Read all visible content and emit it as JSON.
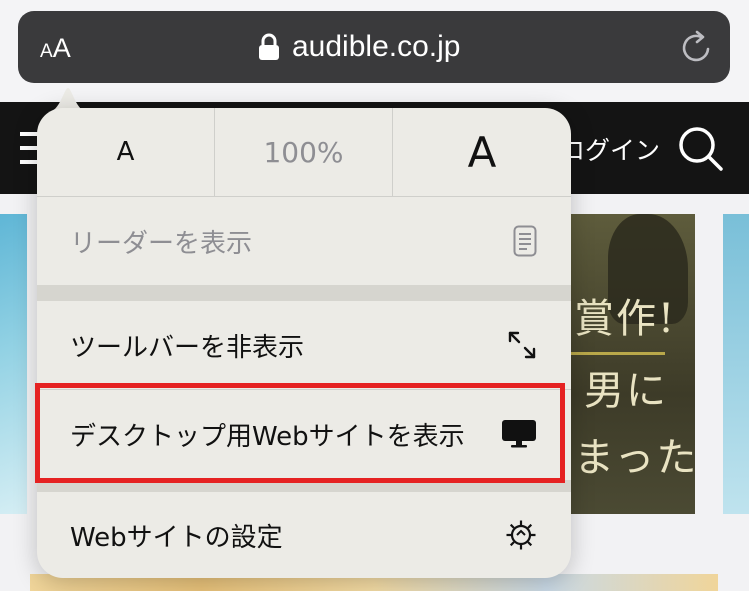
{
  "address_bar": {
    "text_size_small": "A",
    "text_size_big": "A",
    "domain": "audible.co.jp"
  },
  "site": {
    "login_text": "ログイン"
  },
  "banner": {
    "line1": "賞作!",
    "line2": "男に",
    "line3": "まった"
  },
  "popover": {
    "zoom": {
      "decrease": "A",
      "level": "100%",
      "increase": "A"
    },
    "items": [
      {
        "label": "リーダーを表示",
        "icon": "reader-icon",
        "enabled": false
      },
      {
        "label": "ツールバーを非表示",
        "icon": "resize-arrows-icon",
        "enabled": true
      },
      {
        "label": "デスクトップ用Webサイトを表示",
        "icon": "desktop-icon",
        "enabled": true,
        "highlighted": true
      },
      {
        "label": "Webサイトの設定",
        "icon": "gear-icon",
        "enabled": true
      }
    ]
  },
  "colors": {
    "highlight": "#e52222",
    "address_bar": "#3a3a3c",
    "popover": "#ecebe6"
  }
}
